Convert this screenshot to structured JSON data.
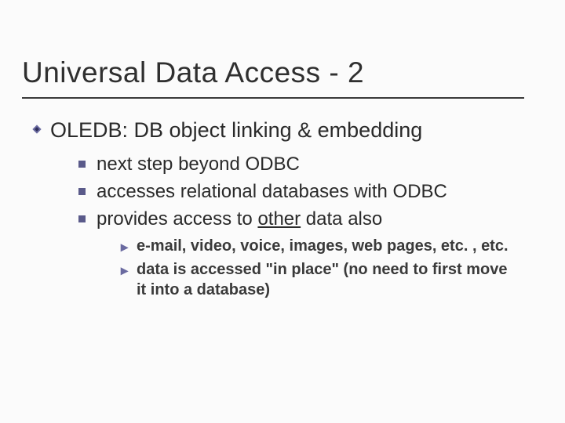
{
  "title": "Universal Data Access - 2",
  "lvl1": {
    "text": "OLEDB: DB object linking & embedding"
  },
  "lvl2": [
    {
      "text": "next step beyond ODBC"
    },
    {
      "text": "accesses relational databases with ODBC"
    },
    {
      "pre": "provides access to ",
      "under": "other",
      "post": " data also"
    }
  ],
  "lvl3": [
    {
      "text": "e-mail, video, voice, images, web pages, etc. , etc."
    },
    {
      "text": "data is accessed \"in place\" (no need to first move it into a database)"
    }
  ],
  "bullets": {
    "caret": "▸"
  }
}
